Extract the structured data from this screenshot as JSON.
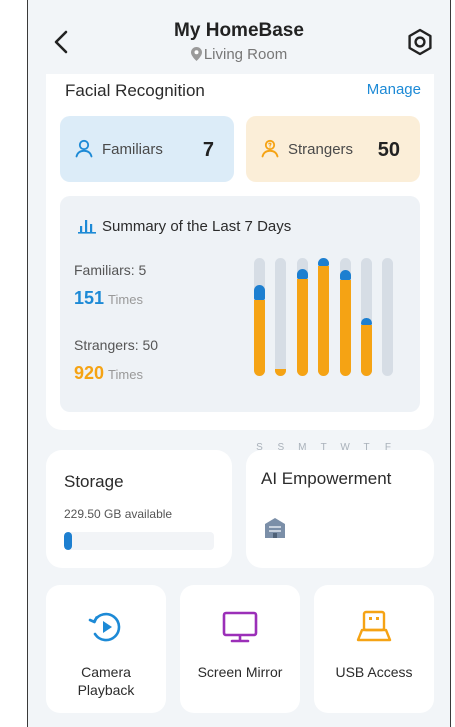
{
  "header": {
    "title": "My HomeBase",
    "location": "Living Room"
  },
  "facial_recognition": {
    "title": "Facial Recognition",
    "manage_label": "Manage",
    "familiars": {
      "label": "Familiars",
      "value": "7"
    },
    "strangers": {
      "label": "Strangers",
      "value": "50"
    }
  },
  "summary": {
    "title": "Summary of the Last 7 Days",
    "familiars_label": "Familiars: 5",
    "familiars_times": "151",
    "strangers_label": "Strangers: 50",
    "strangers_times": "920",
    "times_unit": "Times"
  },
  "chart_data": {
    "type": "bar",
    "categories": [
      "S",
      "S",
      "M",
      "T",
      "W",
      "T",
      "F"
    ],
    "series": [
      {
        "values": [
          0.64,
          0.06,
          0.82,
          0.93,
          0.81,
          0.43,
          0.0
        ]
      },
      {
        "values": [
          0.13,
          0.0,
          0.09,
          0.09,
          0.09,
          0.06,
          0.0
        ]
      }
    ],
    "ylim": [
      0,
      1
    ],
    "colors": [
      "#f5a314",
      "#1d7fd0"
    ],
    "track_color": "#d6dde5"
  },
  "storage": {
    "title": "Storage",
    "available": "229.50 GB available",
    "used_fraction": 0.05
  },
  "ai": {
    "title": "AI Empowerment"
  },
  "tiles": [
    {
      "label": "Camera Playback",
      "icon": "camera-playback-icon"
    },
    {
      "label": "Screen Mirror",
      "icon": "screen-mirror-icon"
    },
    {
      "label": "USB Access",
      "icon": "usb-access-icon"
    }
  ],
  "colors": {
    "accent_blue": "#1d8ad6",
    "accent_orange": "#f5a314",
    "purple": "#9b2fb8"
  }
}
